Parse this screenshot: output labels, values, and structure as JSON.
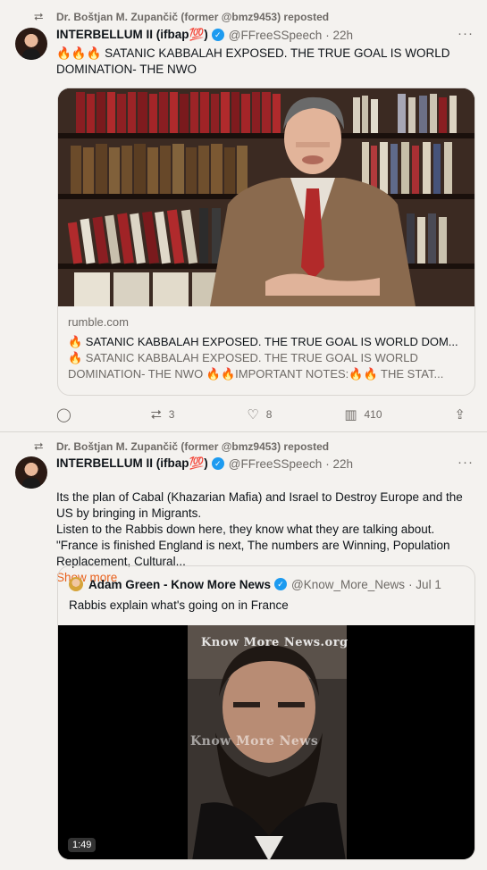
{
  "posts": [
    {
      "repost_by": "Dr. Boštjan M. Zupančič (former @bmz9453) reposted",
      "author_name": "INTERBELLUM II (ifbap💯)",
      "handle": "@FFreeSSpeech",
      "time": "· 22h",
      "text": "🔥🔥🔥 SATANIC KABBALAH EXPOSED. THE TRUE GOAL IS WORLD DOMINATION- THE NWO",
      "card": {
        "domain": "rumble.com",
        "title": "🔥 SATANIC KABBALAH EXPOSED. THE TRUE GOAL IS WORLD DOM...",
        "description": "🔥 SATANIC KABBALAH EXPOSED. THE TRUE GOAL IS WORLD DOMINATION- THE NWO 🔥🔥IMPORTANT NOTES:🔥🔥 THE STAT..."
      },
      "stats": {
        "replies": "",
        "reposts": "3",
        "likes": "8",
        "views": "410"
      }
    },
    {
      "repost_by": "Dr. Boštjan M. Zupančič (former @bmz9453) reposted",
      "author_name": "INTERBELLUM II (ifbap💯)",
      "handle": "@FFreeSSpeech",
      "time": "· 22h",
      "text": "Its the plan of Cabal (Khazarian Mafia) and Israel to Destroy Europe and the US by bringing in Migrants.\nListen to the Rabbis down here, they know what they are talking about.\n\"France is finished England is next, The numbers are Winning, Population Replacement, Cultural...",
      "show_more": "Show more",
      "quote": {
        "author_name": "Adam Green - Know More News",
        "handle": "@Know_More_News",
        "time": "· Jul 1",
        "text": "Rabbis explain what's going on in France",
        "watermark_top": "Know More News.org",
        "watermark_mid": "Know More News",
        "duration": "1:49"
      }
    }
  ],
  "icons": {
    "repost": "repost-icon",
    "more": "more-icon",
    "verified": "verified-badge-icon",
    "reply": "reply-icon",
    "like": "heart-icon",
    "views": "views-icon",
    "share": "share-icon"
  },
  "colors": {
    "background": "#f4f2ef",
    "accent": "#1d9bf0",
    "show_more": "#e8601c"
  }
}
